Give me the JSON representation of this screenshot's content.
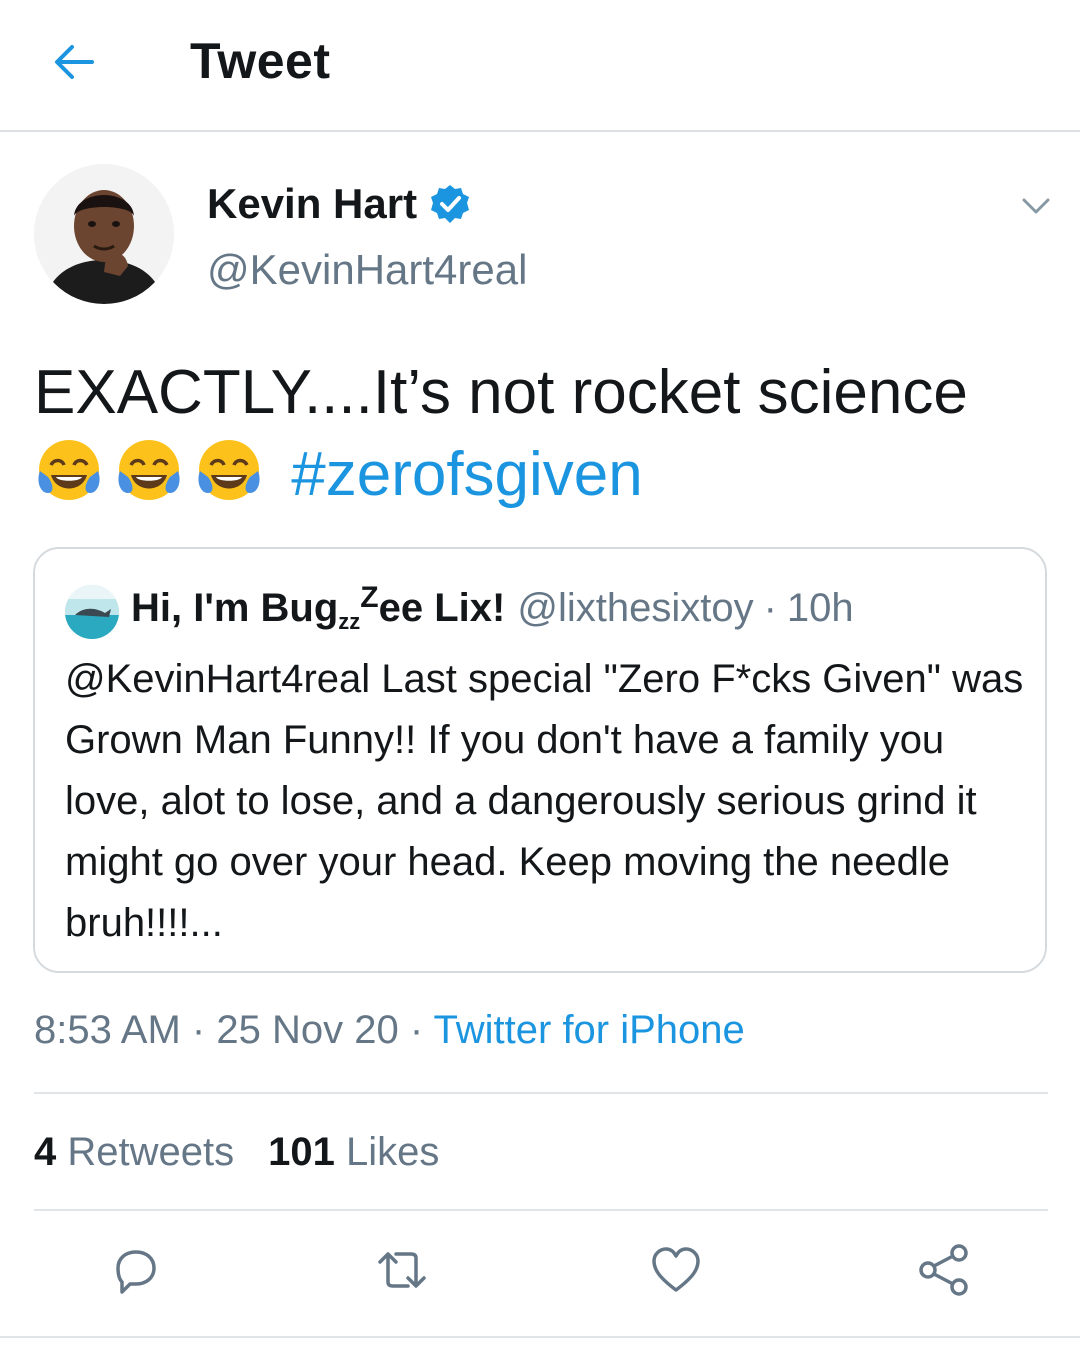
{
  "header": {
    "title": "Tweet",
    "back_icon": "arrow-left-icon"
  },
  "colors": {
    "accent": "#1b95e0",
    "text": "#14171a",
    "muted": "#657786",
    "border": "#d5dade"
  },
  "author": {
    "name": "Kevin Hart",
    "handle": "@KevinHart4real",
    "verified": true
  },
  "tweet": {
    "text": "EXACTLY....It’s not rocket science",
    "emojis": [
      "😂",
      "😂",
      "😂"
    ],
    "hashtag": "#zerofsgiven"
  },
  "quoted_tweet": {
    "name_part1": "Hi, I'm Bug",
    "name_sub": "z",
    "name_sub2": "z",
    "name_sup": "Z",
    "name_part2": "ee Lix!",
    "handle": "@lixthesixtoy",
    "separator": "·",
    "time": "10h",
    "text": "@KevinHart4real Last special \"Zero F*cks Given\" was Grown Man Funny!! If you don't have a family you love, alot to lose, and a dangerously serious grind it might go over your head. Keep moving the needle bruh!!!!..."
  },
  "meta": {
    "time": "8:53 AM",
    "separator": "·",
    "date": "25 Nov 20",
    "client": "Twitter for iPhone"
  },
  "stats": {
    "retweets_count": "4",
    "retweets_label": "Retweets",
    "likes_count": "101",
    "likes_label": "Likes"
  },
  "actions": [
    "reply-icon",
    "retweet-icon",
    "like-icon",
    "share-icon"
  ]
}
